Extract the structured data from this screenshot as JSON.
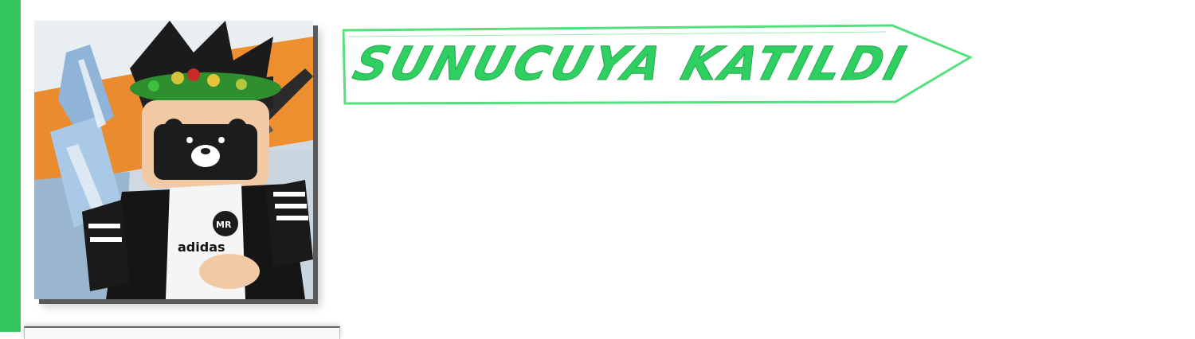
{
  "event": {
    "title": "Sunucuya Katıldı"
  },
  "user": {
    "avatar": "roblox-avatar-image"
  },
  "colors": {
    "accent": "#35c75f",
    "title_fill": "#2fcf62",
    "banner_stroke": "#4fe37a"
  }
}
